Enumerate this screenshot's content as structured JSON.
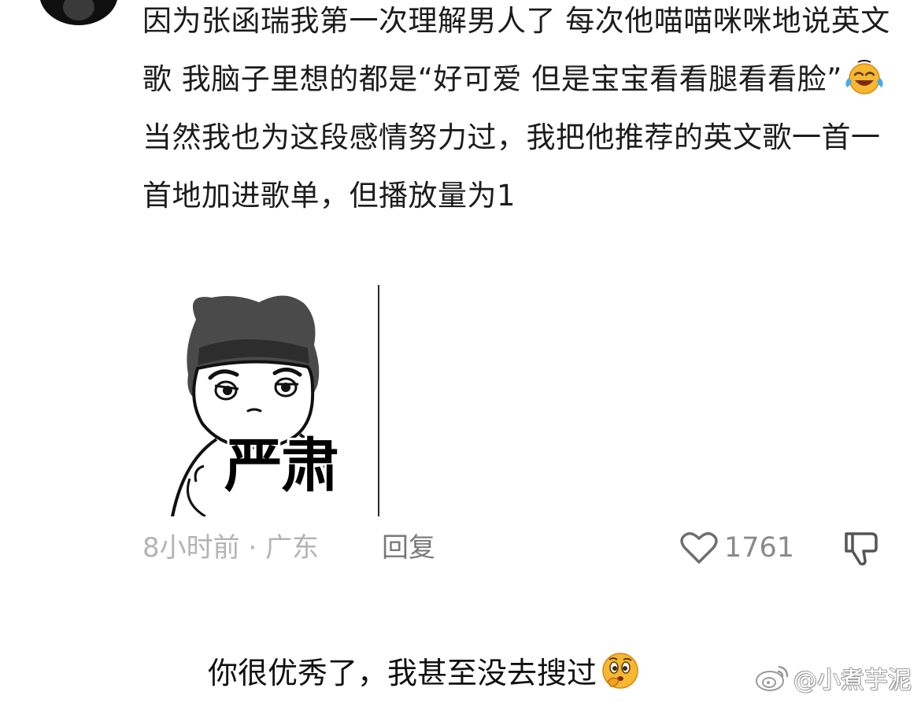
{
  "comment": {
    "text_before_emoji": "因为张函瑞我第一次理解男人了 每次他喵喵咪咪地说英文歌 我脑子里想的都是“好可爱 但是宝宝看看腿看看脸”",
    "emoji": "face-with-tears-of-joy-icon",
    "text_after_emoji": "当然我也为这段感情努力过，我把他推荐的英文歌一首一首地加进歌单，但播放量为1",
    "sticker_caption": "严肃",
    "meta": "8小时前 · 广东",
    "reply_label": "回复",
    "like_count": "1761"
  },
  "bottom_caption": {
    "text": "你很优秀了，我甚至没去搜过",
    "emoji": "thinking-face-icon"
  },
  "watermark": {
    "text": "@小煮芋泥",
    "icon": "weibo-logo"
  },
  "colors": {
    "text": "#1c1c1c",
    "meta": "#b3b3b3",
    "reply": "#7a7a7a",
    "icon": "#6f6f6f",
    "emoji_yellow": "#f7b731"
  }
}
